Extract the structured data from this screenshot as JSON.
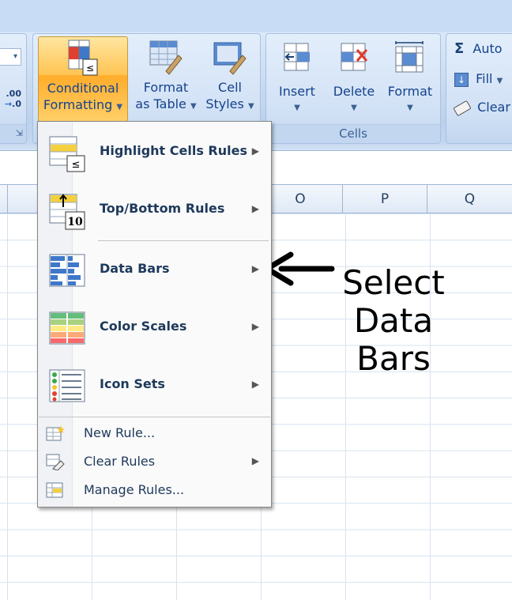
{
  "ribbon": {
    "conditional_formatting": {
      "line1": "Conditional",
      "line2": "Formatting"
    },
    "format_as_table": {
      "line1": "Format",
      "line2": "as Table"
    },
    "cell_styles": {
      "line1": "Cell",
      "line2": "Styles"
    },
    "cells_group": {
      "insert": "Insert",
      "delete": "Delete",
      "format": "Format",
      "label": "Cells"
    },
    "editing_group": {
      "autosum": "Auto",
      "fill": "Fill",
      "clear": "Clear"
    },
    "number_group": {
      "decimal_label": ".00\n→.0"
    }
  },
  "sheet": {
    "columns": [
      "O",
      "P",
      "Q"
    ]
  },
  "menu": {
    "items": [
      {
        "label": "Highlight Cells Rules",
        "icon": "highlight-cells-icon"
      },
      {
        "label": "Top/Bottom Rules",
        "icon": "top-bottom-icon"
      },
      {
        "label": "Data Bars",
        "icon": "data-bars-icon"
      },
      {
        "label": "Color Scales",
        "icon": "color-scales-icon"
      },
      {
        "label": "Icon Sets",
        "icon": "icon-sets-icon"
      }
    ],
    "actions": [
      {
        "label": "New Rule...",
        "icon": "new-rule-icon"
      },
      {
        "label": "Clear Rules",
        "icon": "clear-rules-icon"
      },
      {
        "label": "Manage Rules...",
        "icon": "manage-rules-icon"
      }
    ]
  },
  "annotation": {
    "line1": "Select",
    "line2": "Data Bars"
  },
  "colors": {
    "accent_orange": "#ffc453",
    "ribbon_blue": "#c4daf3",
    "menu_text": "#1e395b"
  }
}
